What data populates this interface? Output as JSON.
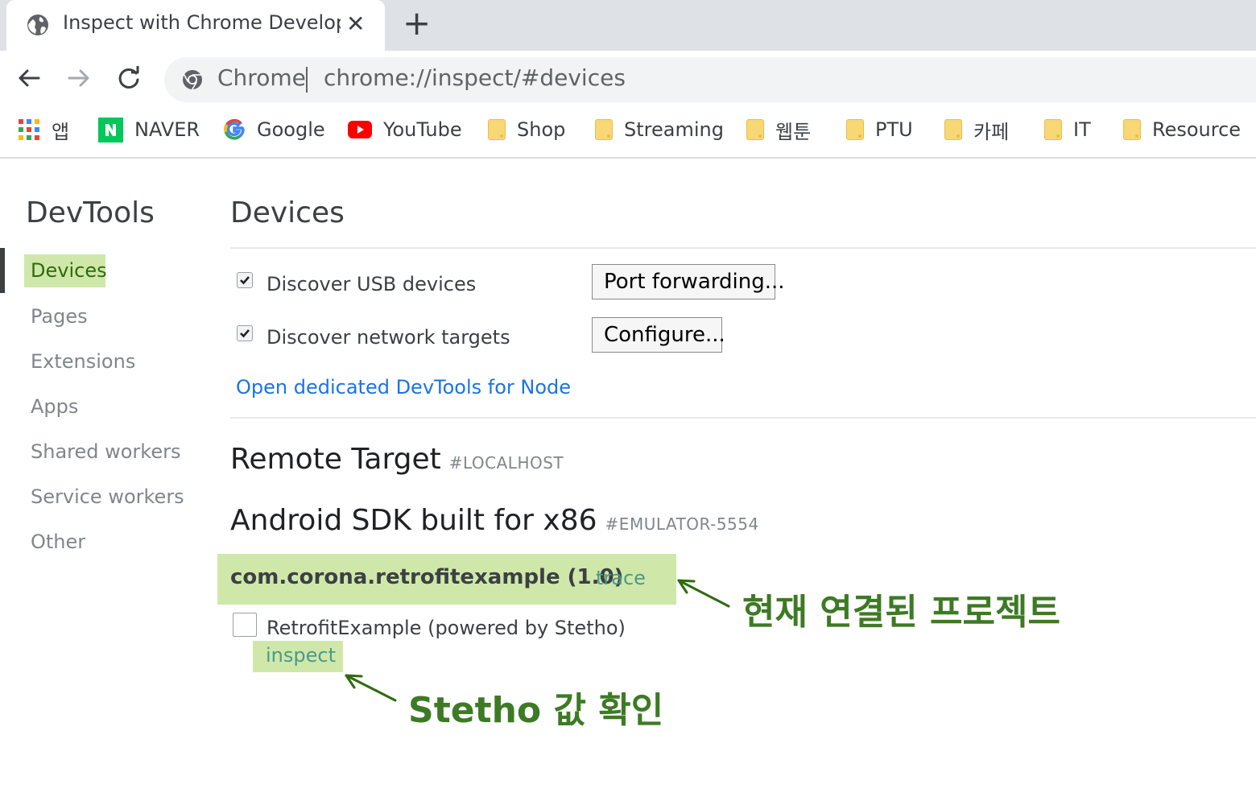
{
  "tab": {
    "title": "Inspect with Chrome Developer",
    "close": "✕",
    "new_tab": "+"
  },
  "toolbar": {
    "omnibox_label": "Chrome",
    "url": "chrome://inspect/#devices"
  },
  "bookmarks": [
    {
      "label": "앱",
      "icon": "apps-grid-icon"
    },
    {
      "label": "NAVER",
      "icon": "naver-icon"
    },
    {
      "label": "Google",
      "icon": "google-icon"
    },
    {
      "label": "YouTube",
      "icon": "youtube-icon"
    },
    {
      "label": "Shop",
      "icon": "folder-icon"
    },
    {
      "label": "Streaming",
      "icon": "folder-icon"
    },
    {
      "label": "웹툰",
      "icon": "folder-icon"
    },
    {
      "label": "PTU",
      "icon": "folder-icon"
    },
    {
      "label": "카페",
      "icon": "folder-icon"
    },
    {
      "label": "IT",
      "icon": "folder-icon"
    },
    {
      "label": "Resource",
      "icon": "folder-icon"
    }
  ],
  "sidebar": {
    "title": "DevTools",
    "items": [
      {
        "label": "Devices"
      },
      {
        "label": "Pages"
      },
      {
        "label": "Extensions"
      },
      {
        "label": "Apps"
      },
      {
        "label": "Shared workers"
      },
      {
        "label": "Service workers"
      },
      {
        "label": "Other"
      }
    ]
  },
  "main": {
    "title": "Devices",
    "discover_usb": {
      "label": "Discover USB devices",
      "checked": true
    },
    "discover_network": {
      "label": "Discover network targets",
      "checked": true
    },
    "port_forwarding_button": "Port forwarding...",
    "configure_button": "Configure...",
    "node_link": "Open dedicated DevTools for Node",
    "remote_target": {
      "title": "Remote Target",
      "tag": "#LOCALHOST"
    },
    "device": {
      "name": "Android SDK built for x86",
      "tag": "#EMULATOR-5554"
    },
    "package": {
      "name": "com.corona.retrofitexample (1.0)",
      "trace": "trace"
    },
    "page": {
      "title": "RetrofitExample (powered by Stetho)",
      "inspect": "inspect"
    }
  },
  "annotations": {
    "project": "현재 연결된 프로젝트",
    "stetho": "Stetho 값 확인"
  },
  "colors": {
    "highlight": "#cfe8a9",
    "annotation": "#3d7a24",
    "link": "#1a73e8",
    "folder": "#f8d775"
  }
}
